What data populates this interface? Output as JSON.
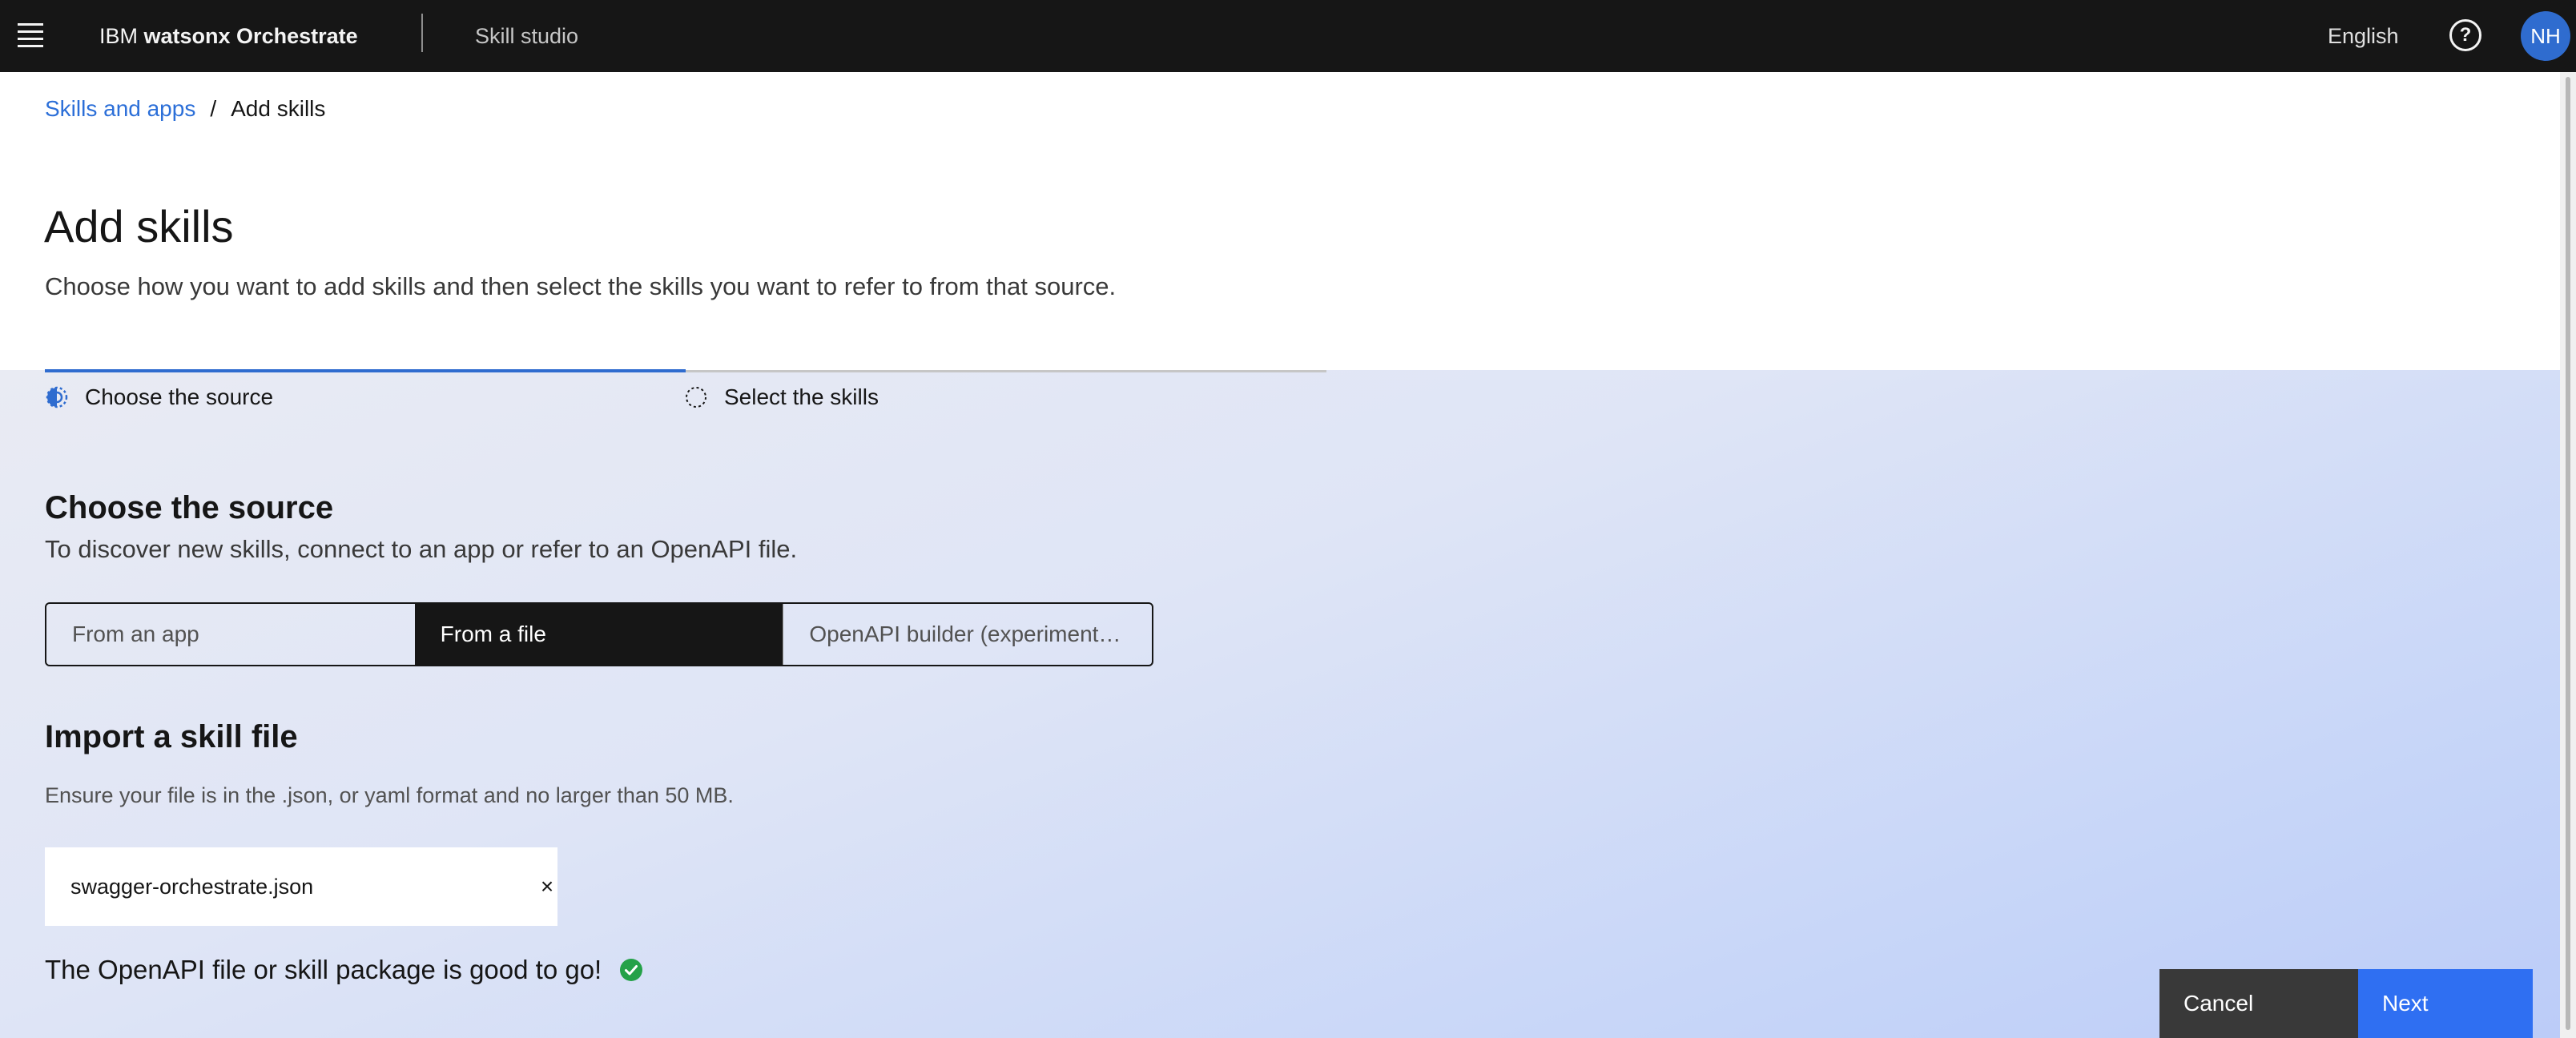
{
  "header": {
    "brand_prefix": "IBM",
    "brand_product": "watsonx Orchestrate",
    "section": "Skill studio",
    "language": "English",
    "help_symbol": "?",
    "avatar_initials": "NH",
    "avatar_color": "#2f6ccf"
  },
  "breadcrumb": {
    "parent": "Skills and apps",
    "separator": "/",
    "current": "Add skills"
  },
  "page": {
    "title": "Add skills",
    "description": "Choose how you want to add skills and then select the skills you want to refer to from that source."
  },
  "progress": {
    "steps": [
      {
        "label": "Choose the source",
        "state": "current"
      },
      {
        "label": "Select the skills",
        "state": "incomplete"
      }
    ],
    "accent": "#2f6ccf"
  },
  "source": {
    "title": "Choose the source",
    "description": "To discover new skills, connect to an app or refer to an OpenAPI file.",
    "options": [
      {
        "label": "From an app",
        "selected": false
      },
      {
        "label": "From a file",
        "selected": true
      },
      {
        "label": "OpenAPI builder (experimental)",
        "selected": false
      }
    ]
  },
  "import": {
    "title": "Import a skill file",
    "description": "Ensure your file is in the .json, or yaml format and no larger than 50 MB.",
    "file_name": "swagger-orchestrate.json",
    "remove_symbol": "×",
    "status_text": "The OpenAPI file or skill package is good to go!",
    "status_color": "#24a148"
  },
  "footer": {
    "cancel_label": "Cancel",
    "next_label": "Next",
    "next_color": "#2f6ff2"
  }
}
